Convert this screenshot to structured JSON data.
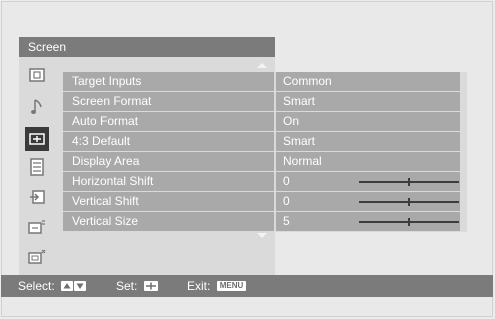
{
  "menu": {
    "title": "Screen",
    "categories": [
      {
        "icon": "picture-icon"
      },
      {
        "icon": "sound-icon"
      },
      {
        "icon": "screen-icon"
      },
      {
        "icon": "setup-icon"
      },
      {
        "icon": "input-icon"
      },
      {
        "icon": "parental-lock-icon"
      },
      {
        "icon": "channel-setup-icon"
      }
    ],
    "rows": [
      {
        "label": "Target Inputs",
        "value": "Common"
      },
      {
        "label": "Screen Format",
        "value": "Smart"
      },
      {
        "label": "Auto Format",
        "value": "On"
      },
      {
        "label": "4:3 Default",
        "value": "Smart"
      },
      {
        "label": "Display Area",
        "value": "Normal"
      },
      {
        "label": "Horizontal Shift",
        "value": "0",
        "slider_fraction": 0.5
      },
      {
        "label": "Vertical Shift",
        "value": "0",
        "slider_fraction": 0.5
      },
      {
        "label": "Vertical Size",
        "value": "5",
        "slider_fraction": 0.5
      }
    ]
  },
  "footer": {
    "select_label": "Select:",
    "set_label": "Set:",
    "exit_label": "Exit:",
    "exit_key": "MENU"
  },
  "colors": {
    "header_bg": "#7b7b7b",
    "row_bg": "#a9a9a9",
    "active_icon_bg": "#3a3a3a"
  }
}
